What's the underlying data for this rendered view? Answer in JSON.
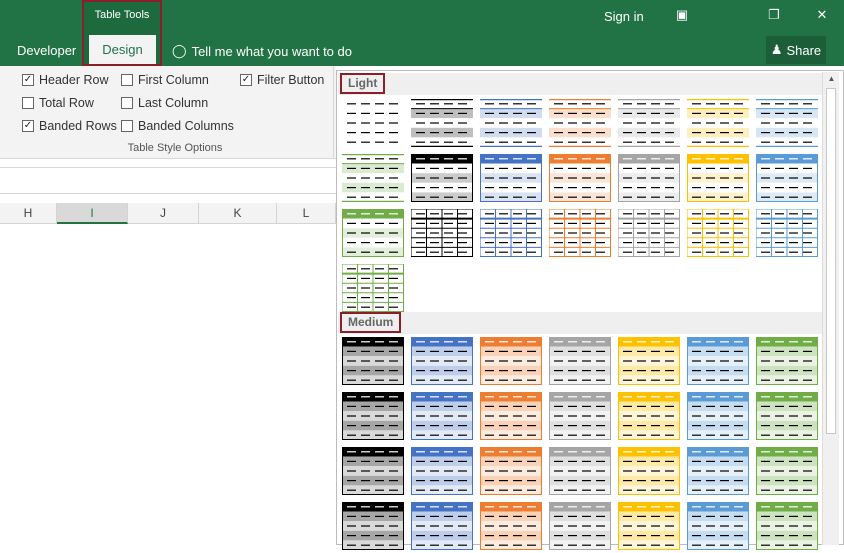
{
  "titlebar": {
    "context_group": "Table Tools",
    "sign_in": "Sign in",
    "restore_icon": "ribbon-display-icon",
    "maximize_icon": "restore-down-icon",
    "close_icon": "close-icon"
  },
  "tabs": {
    "developer": "Developer",
    "design": "Design",
    "tell_me": "Tell me what you want to do",
    "share": "Share"
  },
  "options": {
    "header_row": {
      "label": "Header Row",
      "checked": true
    },
    "total_row": {
      "label": "Total Row",
      "checked": false
    },
    "banded_rows": {
      "label": "Banded Rows",
      "checked": true
    },
    "first_column": {
      "label": "First Column",
      "checked": false
    },
    "last_column": {
      "label": "Last Column",
      "checked": false
    },
    "banded_columns": {
      "label": "Banded Columns",
      "checked": false
    },
    "filter_button": {
      "label": "Filter Button",
      "checked": true
    },
    "group_label": "Table Style Options"
  },
  "columns": [
    "H",
    "I",
    "J",
    "K",
    "L"
  ],
  "selected_column": "I",
  "gallery": {
    "light_label": "Light",
    "medium_label": "Medium",
    "colors": {
      "none": "#ffffff",
      "black": "#000000",
      "blue": "#4472c4",
      "orange": "#ed7d31",
      "gray": "#a5a5a5",
      "gold": "#ffc000",
      "lightblue": "#5b9bd5",
      "green": "#70ad47"
    },
    "light_rows": [
      [
        "plain-none",
        "plain-black",
        "plain-blue",
        "plain-orange",
        "plain-gray",
        "plain-gold",
        "plain-lightblue"
      ],
      [
        "plain-green",
        "header-black",
        "header-blue",
        "header-orange",
        "header-gray",
        "header-gold",
        "header-lightblue"
      ],
      [
        "header-green",
        "grid-black",
        "grid-blue",
        "grid-orange",
        "grid-gray",
        "grid-gold",
        "grid-lightblue"
      ],
      [
        "grid-green"
      ]
    ],
    "medium_rows": [
      [
        "medium-black",
        "medium-blue",
        "medium-orange",
        "medium-gray",
        "medium-gold",
        "medium-lightblue",
        "medium-green"
      ],
      [
        "medium-black",
        "medium-blue",
        "medium-orange",
        "medium-gray",
        "medium-gold",
        "medium-lightblue",
        "medium-green"
      ],
      [
        "medium-black",
        "medium-blue",
        "medium-orange",
        "medium-gray",
        "medium-gold",
        "medium-lightblue",
        "medium-green"
      ],
      [
        "medium-black",
        "medium-blue",
        "medium-orange",
        "medium-gray",
        "medium-gold",
        "medium-lightblue",
        "medium-green"
      ]
    ]
  }
}
